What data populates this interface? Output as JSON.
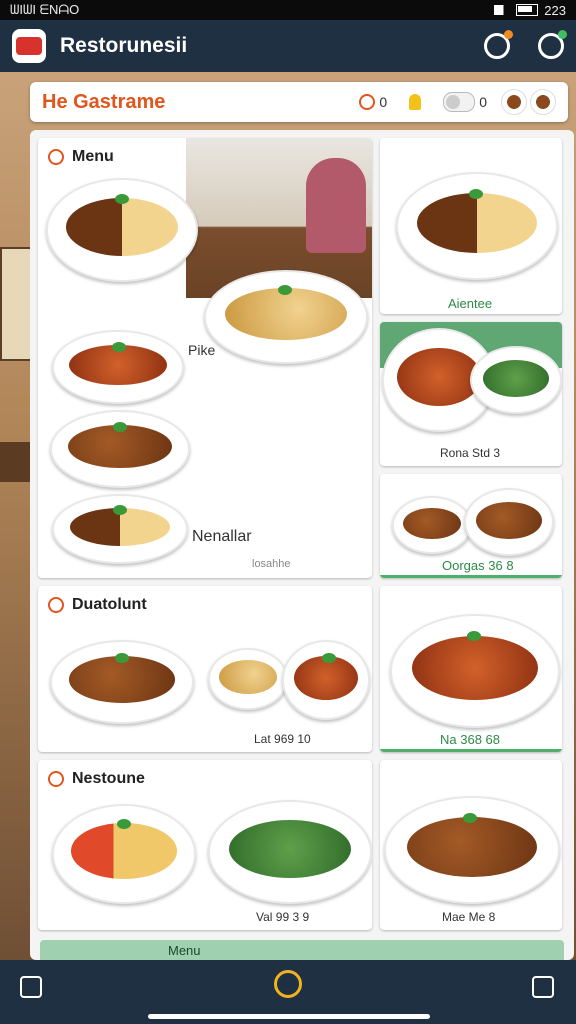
{
  "status": {
    "left": "ᗯIᗯI ᗴNᗩO",
    "time": "223"
  },
  "app": {
    "title": "Restorunesii"
  },
  "header": {
    "title": "He Gastrame",
    "timer_value": "0",
    "toggle_value": "0"
  },
  "menu_card": {
    "title": "Menu",
    "label_pike": "Pike",
    "label_nenalar": "Nenallar",
    "caption": "losahhe"
  },
  "right_top": {
    "caption": "Aientee"
  },
  "right_mid": {
    "caption": "Rona Std 3"
  },
  "right_low": {
    "caption": "Oorgas 36 8"
  },
  "section2": {
    "title": "Duatolunt",
    "caption_left": "Lat 969 10",
    "caption_right": "Na 368 68"
  },
  "section3": {
    "title": "Nestoune",
    "caption_left": "Val 99 3 9",
    "caption_right": "Mae Me 8"
  },
  "peek": {
    "label": "Menu"
  },
  "colors": {
    "appbar": "#1f3042",
    "accent": "#e0561c",
    "green": "#2e8a47"
  },
  "icons": [
    "clock-icon",
    "bell-icon",
    "settings-icon",
    "home-icon",
    "share-icon"
  ]
}
